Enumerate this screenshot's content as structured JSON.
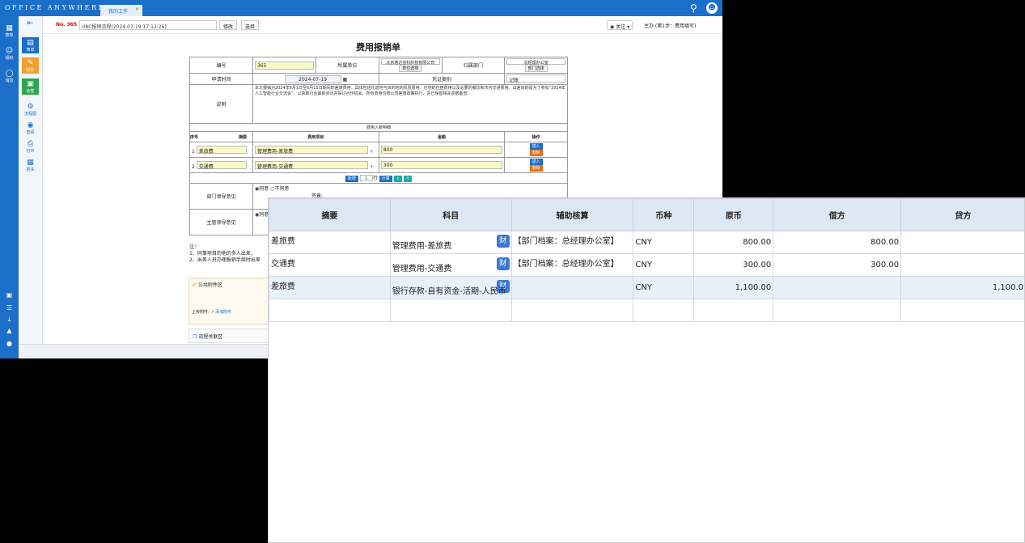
{
  "app": {
    "logo": "OFFICE ANYWHERE",
    "tab": "我的工作",
    "tab_close": "×"
  },
  "sidebar": [
    {
      "icon": "grid-icon",
      "label": "菜单"
    },
    {
      "icon": "users-icon",
      "label": "组织"
    },
    {
      "icon": "chat-icon",
      "label": "消息"
    }
  ],
  "sidebar2": [
    {
      "icon": "doc-icon",
      "label": "表单"
    },
    {
      "icon": "clip-icon",
      "label": "附件"
    },
    {
      "icon": "seal-icon",
      "label": "会签"
    },
    {
      "icon": "flow-icon",
      "label": "流程图"
    },
    {
      "icon": "eye-icon",
      "label": "查阅"
    },
    {
      "icon": "print-icon",
      "label": "打印"
    },
    {
      "icon": "more-icon",
      "label": "更多"
    }
  ],
  "formbar": {
    "no": "No. 365",
    "title": "U8C报销流程(2024-07-19 17:12:26)",
    "btn_edit": "修改",
    "btn_select": "选择",
    "follow": "关注",
    "step": "主办 (第1步：费用填写)"
  },
  "form": {
    "title": "费用报销单",
    "labels": {
      "id": "编号",
      "unit": "所属单位",
      "dept": "归属部门",
      "date": "申请时间",
      "voucher": "凭证类别",
      "desc": "说明",
      "detail": "费用入账明细",
      "no": "序号",
      "summary": "摘要",
      "item": "费用项目",
      "amount": "金额",
      "op": "操作",
      "dept_leader": "部门领导意见",
      "main_leader": "主管领导意见"
    },
    "id": "365",
    "unit": "北京通达信科科技有限公司",
    "unit_btn": "单位选择",
    "dept": "总经理办公室",
    "dept_btn": "部门选择",
    "date": "2024-07-19",
    "voucher": "记账",
    "desc": "本次报销为2024年6月1日至6月15日期间的差旅费用。具体包括往返地与目的地的机票费用、在地的住宿费用以及必要的餐饮和市内交通费用。出差目的是为了参加“2024年人工智能行业交流会”，以获取行业最新资讯并探讨合作机会。所有费用均按公司差旅政策执行，并已保留相关票据备查。",
    "rows": [
      {
        "no": "1",
        "summary": "差旅费",
        "item": "管理费用-差旅费",
        "amount": "800",
        "ins": "插入",
        "del": "删除"
      },
      {
        "no": "2",
        "summary": "交通费",
        "item": "管理费用-交通费",
        "amount": "300",
        "ins": "插入",
        "del": "删除"
      }
    ],
    "add": "新增",
    "add_count": "1",
    "line": "行",
    "calc": "计算",
    "agree": "同意",
    "disagree": "不同意",
    "opinion": "签章:",
    "notes": [
      "注：",
      "1、同事项目的他的多人出差，",
      "2、出差人员办理报销手续时出差"
    ],
    "annex_title": "公共附件区",
    "upload": "上传附件:",
    "add_annex": "添加附件",
    "flow_area": "流程关联区"
  },
  "voucher": {
    "headers": [
      "摘要",
      "科目",
      "辅助核算",
      "币种",
      "原币",
      "借方",
      "贷方"
    ],
    "rows": [
      {
        "summary": "差旅费",
        "subject": "管理费用-差旅费",
        "aux": "【部门档案：总经理办公室】",
        "currency": "CNY",
        "orig": "800.00",
        "debit": "800.00",
        "credit": ""
      },
      {
        "summary": "交通费",
        "subject": "管理费用-交通费",
        "aux": "【部门档案：总经理办公室】",
        "currency": "CNY",
        "orig": "300.00",
        "debit": "300.00",
        "credit": ""
      },
      {
        "summary": "差旅费",
        "subject": "银行存款-自有资金-活期-人民币",
        "aux": "",
        "currency": "CNY",
        "orig": "1,100.00",
        "debit": "",
        "credit": "1,100.0"
      }
    ],
    "cai": "财"
  }
}
